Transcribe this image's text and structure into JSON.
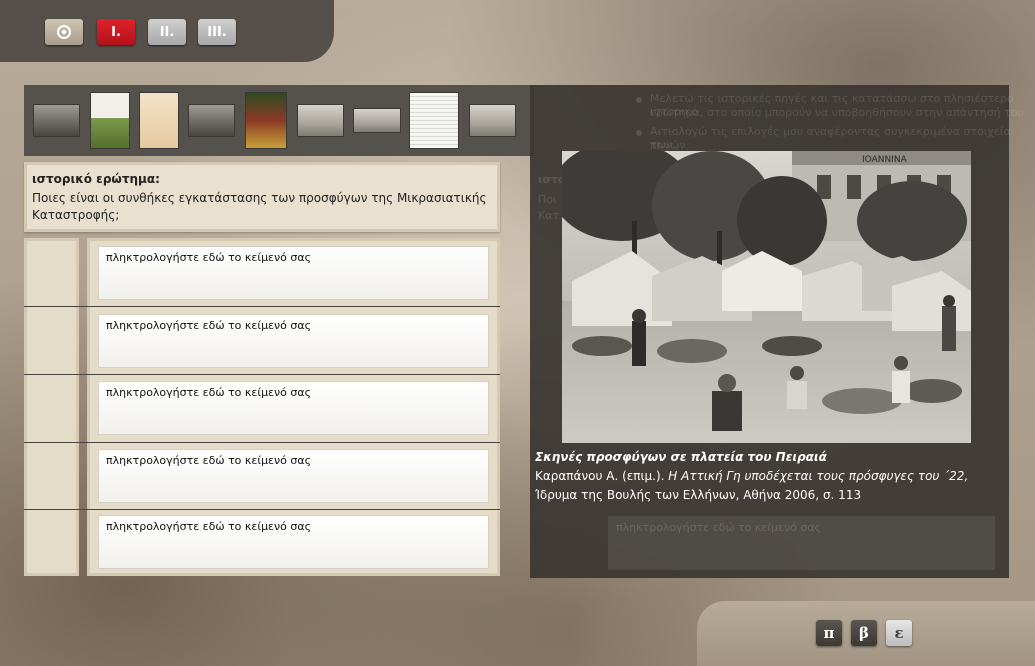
{
  "nav": {
    "home_icon": "compass-icon",
    "tabs": [
      {
        "label": "I.",
        "active": true
      },
      {
        "label": "II.",
        "active": false
      },
      {
        "label": "III.",
        "active": false
      }
    ]
  },
  "thumbnails": [
    {
      "icon": "photo-thumbnail"
    },
    {
      "icon": "book-cover-thumbnail"
    },
    {
      "icon": "book-cover-thumbnail"
    },
    {
      "icon": "photo-thumbnail"
    },
    {
      "icon": "book-cover-thumbnail"
    },
    {
      "icon": "photo-thumbnail"
    },
    {
      "icon": "photo-thumbnail"
    },
    {
      "icon": "newspaper-thumbnail"
    },
    {
      "icon": "photo-thumbnail"
    }
  ],
  "question": {
    "title": "ιστορικό ερώτημα:",
    "text": "Ποιες είναι οι συνθήκες εγκατάστασης των προσφύγων της Μικρασιατικής Καταστροφής;"
  },
  "answers": [
    {
      "placeholder": "πληκτρολογήστε εδώ το κείμενό σας"
    },
    {
      "placeholder": "πληκτρολογήστε εδώ το κείμενό σας"
    },
    {
      "placeholder": "πληκτρολογήστε εδώ το κείμενό σας"
    },
    {
      "placeholder": "πληκτρολογήστε εδώ το κείμενό σας"
    },
    {
      "placeholder": "πληκτρολογήστε εδώ το κείμενό σας"
    }
  ],
  "background_panel": {
    "bullets": [
      "Μελετώ τις ιστορικές πηγές και τις κατατάσσω στο πλησιέστερο ιστορικό",
      "ερώτημα, στο οποίο μπορούν να υποβοηθήσουν στην απάντησή του.",
      "Αιτιολογώ τις επιλογές μου αναφέροντας συγκεκριμένα στοιχεία των",
      "πηγών."
    ],
    "side_labels": [
      "ιστο",
      "Ποι",
      "Κατ"
    ],
    "input_placeholder": "πληκτρολογήστε εδώ το κείμενό σας"
  },
  "popup": {
    "photo_sign": "IOANNINA",
    "caption_title": "Σκηνές προσφύγων σε πλατεία του Πειραιά",
    "source_author": "Καραπάνου Α. (επιμ.). ",
    "source_title": "Η Αττική Γη υποδέχεται τους πρόσφυγες του ΄22,",
    "source_publisher": "Ίδρυμα της Βουλής των Ελλήνων, Αθήνα 2006, σ. 113"
  },
  "bottom_buttons": [
    {
      "label": "π"
    },
    {
      "label": "β"
    },
    {
      "label": "ε"
    }
  ],
  "colors": {
    "active_tab": "#d0191f",
    "panel": "#3a3632",
    "topbar": "#56504b"
  }
}
